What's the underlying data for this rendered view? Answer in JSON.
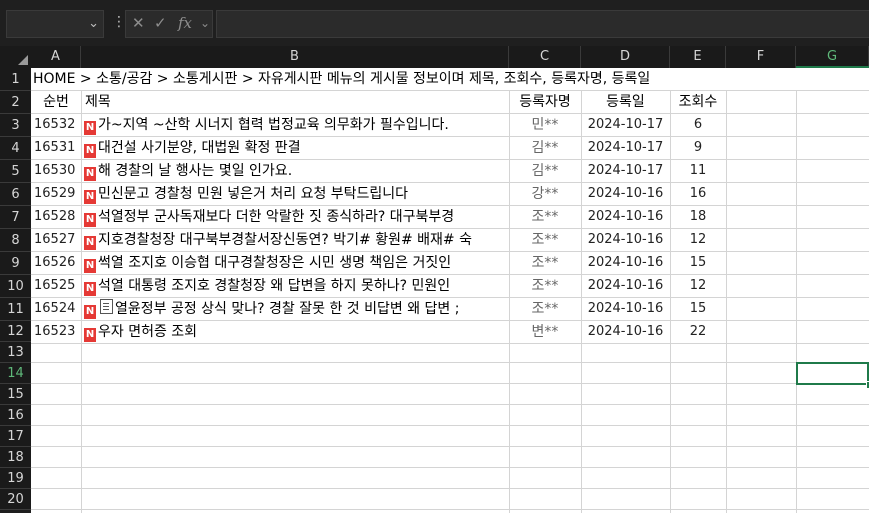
{
  "formula_bar": {
    "name_box": "",
    "formula": ""
  },
  "columns": [
    "A",
    "B",
    "C",
    "D",
    "E",
    "F",
    "G"
  ],
  "rows": [
    "1",
    "2",
    "3",
    "4",
    "5",
    "6",
    "7",
    "8",
    "9",
    "10",
    "11",
    "12",
    "13",
    "14",
    "15",
    "16",
    "17",
    "18",
    "19",
    "20"
  ],
  "sheet": {
    "title_row": "HOME > 소통/공감 > 소통게시판 > 자유게시판 메뉴의 게시물 정보이며 제목, 조회수, 등록자명, 등록일",
    "headers": {
      "no": "순번",
      "title": "제목",
      "author": "등록자명",
      "date": "등록일",
      "views": "조회수"
    },
    "posts": [
      {
        "no": "16532",
        "title": "가~지역 ~산학 시너지 협력 법정교육 의무화가 필수입니다.",
        "author": "민**",
        "date": "2024-10-17",
        "views": "6"
      },
      {
        "no": "16531",
        "title": "대건설 사기분양, 대법원 확정 판결",
        "author": "김**",
        "date": "2024-10-17",
        "views": "9"
      },
      {
        "no": "16530",
        "title": "해 경찰의 날 행사는 몇일 인가요.",
        "author": "김**",
        "date": "2024-10-17",
        "views": "11"
      },
      {
        "no": "16529",
        "title": "민신문고 경찰청 민원 넣은거 처리 요청 부탁드립니다",
        "author": "강**",
        "date": "2024-10-16",
        "views": "16"
      },
      {
        "no": "16528",
        "title": "석열정부 군사독재보다 더한 악랄한 짓 종식하라? 대구북부경",
        "author": "조**",
        "date": "2024-10-16",
        "views": "18"
      },
      {
        "no": "16527",
        "title": "지호경찰청장 대구북부경찰서장신동연? 박기# 황원# 배재# 숙",
        "author": "조**",
        "date": "2024-10-16",
        "views": "12"
      },
      {
        "no": "16526",
        "title": "썩열 조지호 이승협 대구경찰청장은 시민 생명 책임은 거짓인",
        "author": "조**",
        "date": "2024-10-16",
        "views": "15"
      },
      {
        "no": "16525",
        "title": "석열 대통령 조지호 경찰청장 왜 답변을 하지 못하나? 민원인",
        "author": "조**",
        "date": "2024-10-16",
        "views": "12"
      },
      {
        "no": "16524",
        "title": "열윤정부 공정 상식 맞나? 경찰 잘못 한 것 비답변 왜 답변 ;",
        "author": "조**",
        "date": "2024-10-16",
        "views": "15"
      },
      {
        "no": "16523",
        "title": "우자 면허증 조회",
        "author": "변**",
        "date": "2024-10-16",
        "views": "22"
      }
    ]
  },
  "icons": {
    "new_badge": "N"
  }
}
